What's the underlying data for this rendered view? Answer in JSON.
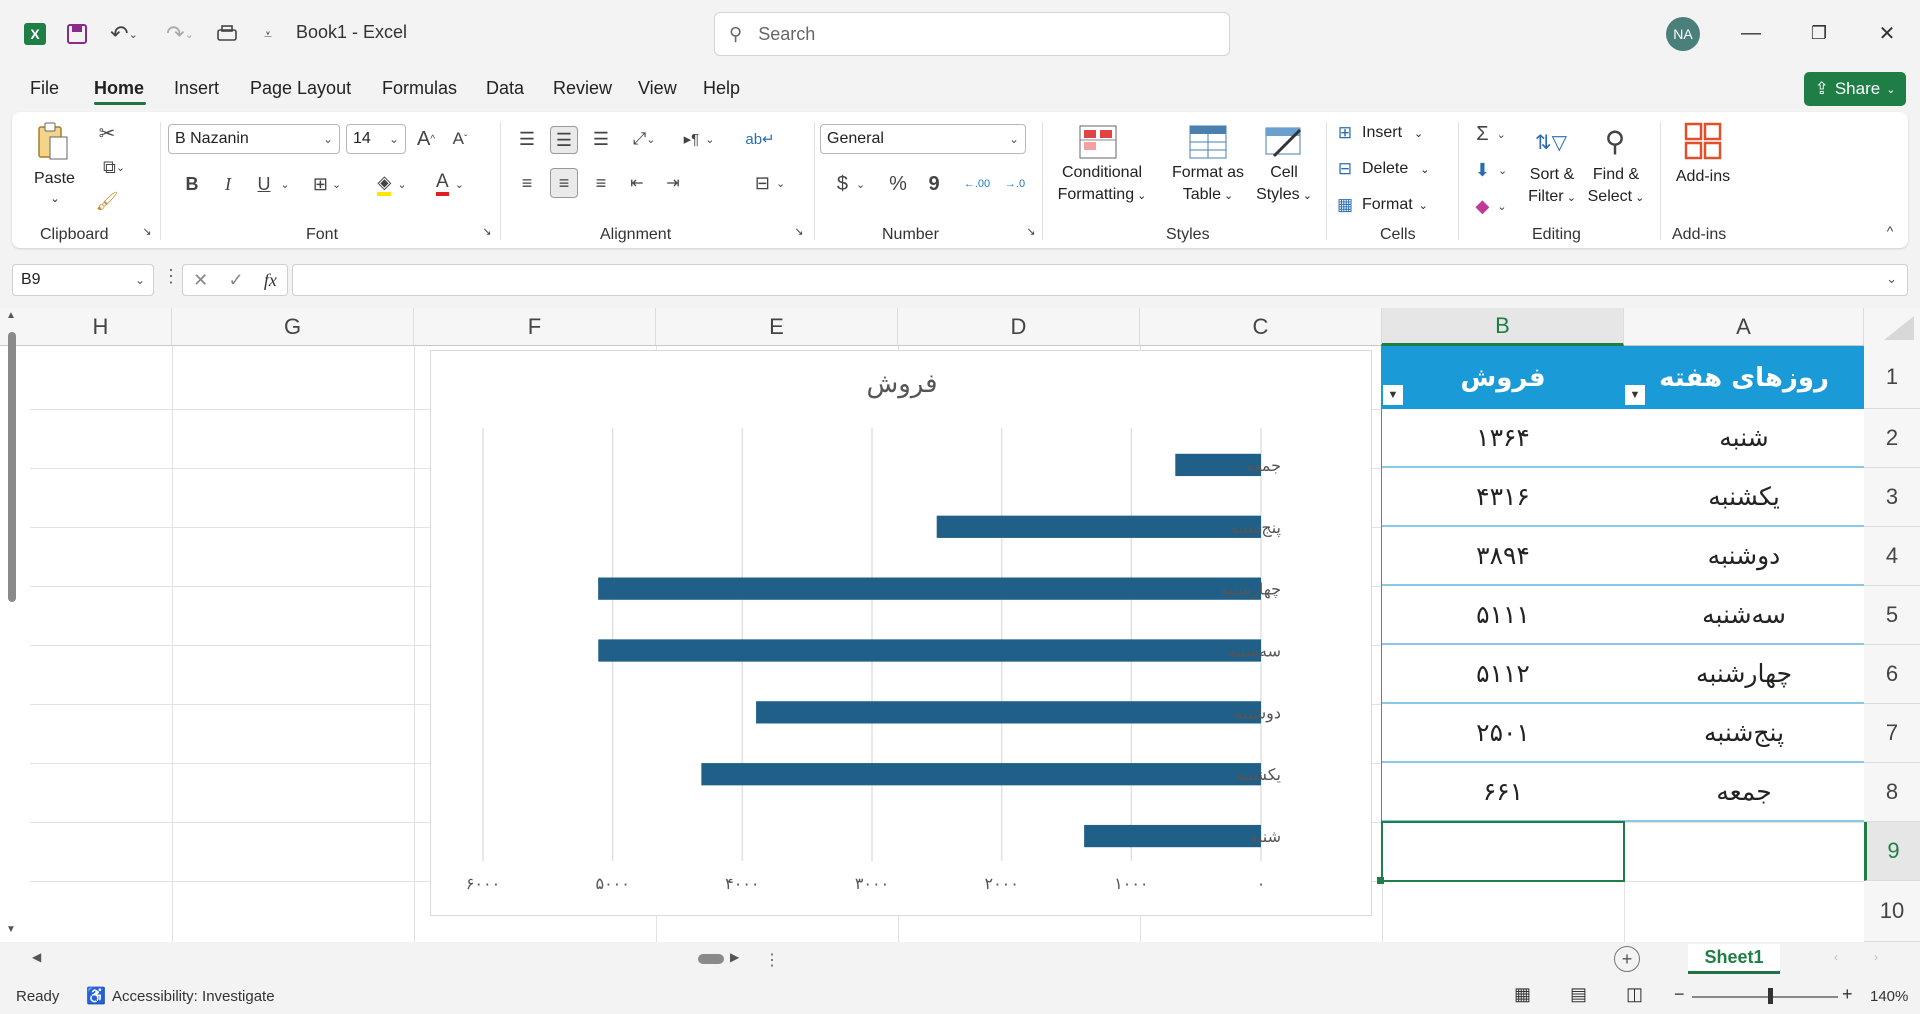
{
  "titlebar": {
    "doc_title": "Book1  -  Excel",
    "search_placeholder": "Search",
    "avatar_initials": "NA"
  },
  "menu": {
    "tabs": [
      "File",
      "Home",
      "Insert",
      "Page Layout",
      "Formulas",
      "Data",
      "Review",
      "View",
      "Help"
    ],
    "active": "Home",
    "share_label": "Share"
  },
  "ribbon": {
    "clipboard": {
      "paste": "Paste",
      "label": "Clipboard"
    },
    "font": {
      "name": "B Nazanin",
      "size": "14",
      "label": "Font",
      "bold": "B",
      "italic": "I",
      "underline": "U",
      "grow": "A",
      "shrink": "A",
      "font_color_glyph": "A"
    },
    "alignment": {
      "label": "Alignment"
    },
    "number": {
      "format": "General",
      "label": "Number",
      "currency": "$",
      "percent": "%",
      "comma": "9",
      "inc_dec": ".00",
      "dec_dec": ".0"
    },
    "styles": {
      "conditional": "Conditional",
      "conditional2": "Formatting",
      "format_table": "Format as",
      "format_table2": "Table",
      "cell_styles": "Cell",
      "cell_styles2": "Styles",
      "label": "Styles"
    },
    "cells": {
      "insert": "Insert",
      "delete": "Delete",
      "format": "Format",
      "label": "Cells"
    },
    "editing": {
      "sort": "Sort &",
      "sort2": "Filter",
      "find": "Find &",
      "find2": "Select",
      "label": "Editing"
    },
    "addins": {
      "addins": "Add-ins",
      "label": "Add-ins"
    }
  },
  "formula_bar": {
    "name_box": "B9",
    "fx": "fx",
    "value": ""
  },
  "columns": [
    "H",
    "G",
    "F",
    "E",
    "D",
    "C",
    "B",
    "A"
  ],
  "rows": [
    "1",
    "2",
    "3",
    "4",
    "5",
    "6",
    "7",
    "8",
    "9",
    "10"
  ],
  "table": {
    "headers": {
      "A": "روزهای هفته",
      "B": "فروش"
    },
    "rows": [
      {
        "A": "شنبه",
        "B": "۱۳۶۴"
      },
      {
        "A": "یکشنبه",
        "B": "۴۳۱۶"
      },
      {
        "A": "دوشنبه",
        "B": "۳۸۹۴"
      },
      {
        "A": "سه‌شنبه",
        "B": "۵۱۱۱"
      },
      {
        "A": "چهارشنبه",
        "B": "۵۱۱۲"
      },
      {
        "A": "پنج‌شنبه",
        "B": "۲۵۰۱"
      },
      {
        "A": "جمعه",
        "B": "۶۶۱"
      }
    ]
  },
  "chart_data": {
    "type": "bar",
    "orientation": "horizontal",
    "title": "فروش",
    "categories": [
      "شنبه",
      "یکشنبه",
      "دوشنبه",
      "سه‌شنبه",
      "چهارشنبه",
      "پنج‌شنبه",
      "جمعه"
    ],
    "values": [
      1364,
      4316,
      3894,
      5111,
      5112,
      2501,
      661
    ],
    "xlim": [
      0,
      6000
    ],
    "x_ticks": [
      0,
      1000,
      2000,
      3000,
      4000,
      5000,
      6000
    ],
    "x_tick_labels": [
      "۰",
      "۱۰۰۰",
      "۲۰۰۰",
      "۳۰۰۰",
      "۴۰۰۰",
      "۵۰۰۰",
      "۶۰۰۰"
    ],
    "reversed_x": true,
    "grid": "vertical",
    "legend": "none",
    "bar_color": "#1f5f88"
  },
  "sheets": {
    "active": "Sheet1"
  },
  "status": {
    "ready": "Ready",
    "accessibility": "Accessibility: Investigate",
    "zoom": "140%"
  },
  "colors": {
    "accent": "#217346",
    "header_fill": "#1a9ad6",
    "bar": "#1f5f88"
  }
}
